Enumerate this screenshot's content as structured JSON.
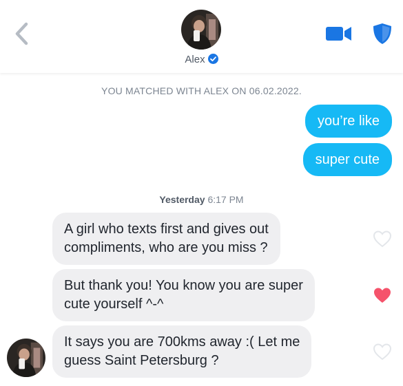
{
  "header": {
    "match_name": "Alex",
    "back_icon": "chevron-left-icon",
    "video_icon": "video-camera-icon",
    "safety_icon": "shield-icon",
    "verified_icon": "verified-check-icon"
  },
  "match_banner": "YOU MATCHED WITH ALEX ON 06.02.2022.",
  "outgoing": [
    {
      "text": "you’re like"
    },
    {
      "text": "super cute"
    }
  ],
  "time_separator": {
    "day": "Yesterday",
    "time": "6:17 PM"
  },
  "incoming": [
    {
      "line1": "A girl who texts first and gives out",
      "line2": "compliments, who are you miss ?",
      "liked": false
    },
    {
      "line1": "But thank you! You know you are super",
      "line2": "cute yourself ^-^",
      "liked": true
    },
    {
      "line1": "It says you are 700kms away :( Let me",
      "line2": "guess Saint Petersburg ?",
      "liked": false
    }
  ],
  "colors": {
    "accent_blue": "#16b9f5",
    "icon_blue": "#1a76e3",
    "like_red": "#f5536b",
    "incoming_bubble": "#efeff1"
  }
}
